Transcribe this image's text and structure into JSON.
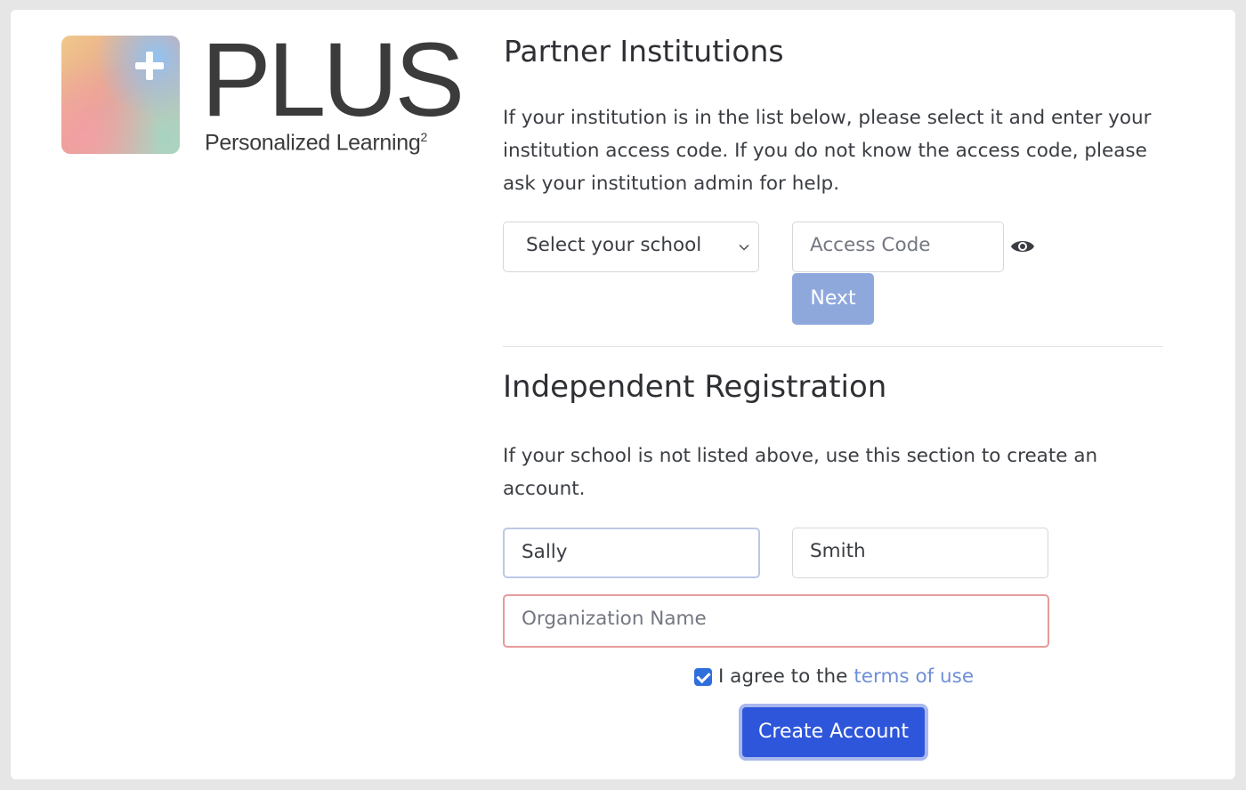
{
  "logo": {
    "word": "PLUS",
    "subtitle": "Personalized Learning",
    "superscript": "2"
  },
  "partner": {
    "heading": "Partner Institutions",
    "description": "If your institution is in the list below, please select it and enter your institution access code. If you do not know the access code, please ask your institution admin for help.",
    "school_select": "Select your school",
    "access_code_placeholder": "Access Code",
    "next_label": "Next"
  },
  "independent": {
    "heading": "Independent Registration",
    "description": "If your school is not listed above, use this section to create an account.",
    "first_name": "Sally",
    "last_name": "Smith",
    "organization_placeholder": "Organization Name",
    "agree_text": "I agree to the",
    "terms_link": "terms of use",
    "create_label": "Create Account"
  },
  "colors": {
    "primary": "#2e56db",
    "next_disabled": "#8fa8dc",
    "link": "#6f8fd6",
    "error_border": "#e79a9a"
  }
}
